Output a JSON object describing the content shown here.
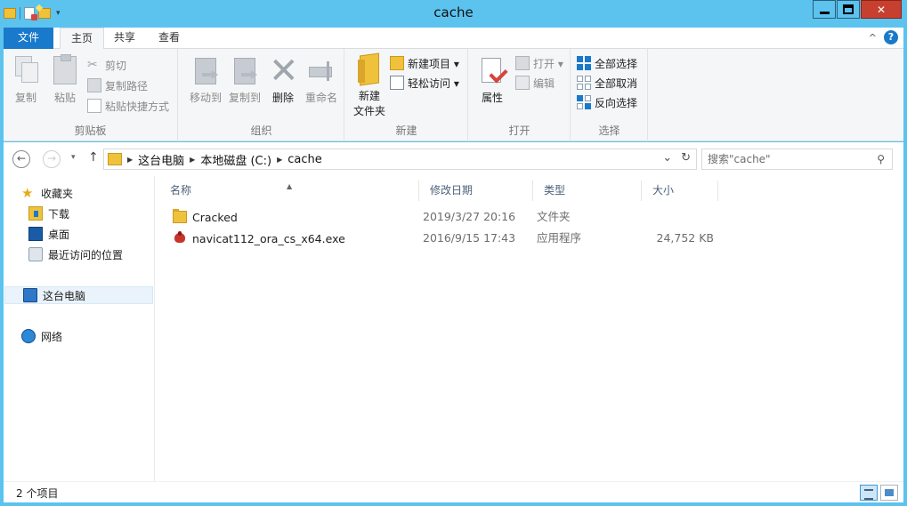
{
  "window": {
    "title": "cache"
  },
  "ribbon_tabs": {
    "file": "文件",
    "home": "主页",
    "share": "共享",
    "view": "查看"
  },
  "ribbon": {
    "clipboard": {
      "label": "剪贴板",
      "copy": "复制",
      "paste": "粘贴",
      "cut": "剪切",
      "copy_path": "复制路径",
      "paste_shortcut": "粘贴快捷方式"
    },
    "organize": {
      "label": "组织",
      "move_to": "移动到",
      "copy_to": "复制到",
      "delete": "删除",
      "rename": "重命名"
    },
    "new": {
      "label": "新建",
      "new_folder_line1": "新建",
      "new_folder_line2": "文件夹",
      "new_item": "新建项目 ▾",
      "easy_access": "轻松访问 ▾"
    },
    "open": {
      "label": "打开",
      "properties": "属性",
      "open": "打开 ▾",
      "edit": "编辑"
    },
    "select": {
      "label": "选择",
      "select_all": "全部选择",
      "select_none": "全部取消",
      "invert": "反向选择"
    }
  },
  "address": {
    "crumbs": [
      "这台电脑",
      "本地磁盘 (C:)",
      "cache"
    ],
    "search_placeholder": "搜索\"cache\""
  },
  "nav": {
    "favorites": "收藏夹",
    "downloads": "下载",
    "desktop": "桌面",
    "recent": "最近访问的位置",
    "this_pc": "这台电脑",
    "network": "网络"
  },
  "columns": {
    "name": "名称",
    "modified": "修改日期",
    "type": "类型",
    "size": "大小"
  },
  "files": [
    {
      "name": "Cracked",
      "modified": "2019/3/27 20:16",
      "type": "文件夹",
      "size": ""
    },
    {
      "name": "navicat112_ora_cs_x64.exe",
      "modified": "2016/9/15 17:43",
      "type": "应用程序",
      "size": "24,752 KB"
    }
  ],
  "status": {
    "count": "2 个项目"
  },
  "colors": {
    "titlebar": "#5cc3ef",
    "file_tab": "#1979ca",
    "close_button": "#c7402f"
  }
}
